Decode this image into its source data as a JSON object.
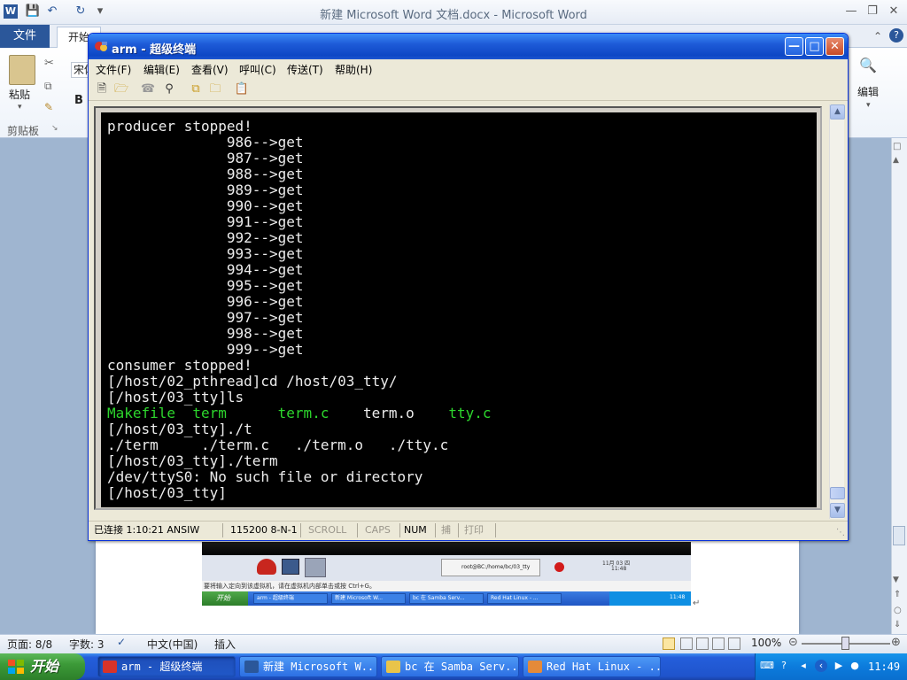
{
  "word": {
    "title": "新建 Microsoft Word 文档.docx  -  Microsoft Word",
    "tab_file": "文件",
    "tab_home": "开始",
    "paste_label": "粘贴",
    "clipboard_group": "剪贴板",
    "font_box": "宋体",
    "bold": "B",
    "edit_label": "编辑",
    "status": {
      "page": "页面: 8/8",
      "words": "字数: 3",
      "language": "中文(中国)",
      "insert_mode": "插入",
      "zoom": "100%"
    }
  },
  "embedded_screenshot": {
    "panel_path": "root@BC:/home/bc/03_tty",
    "panel_clock_date": "11月 03 四",
    "panel_clock_time": "11:48",
    "message": "要将输入定向到该虚拟机，请在虚拟机内部单击或按 Ctrl+G。",
    "start": "开始",
    "tasks": [
      "arm - 超级终端",
      "新建 Microsoft W...",
      "bc 在 Samba Serv...",
      "Red Hat Linux - ..."
    ],
    "tray_time": "11:48"
  },
  "hyperterminal": {
    "title": "arm - 超级终端",
    "menu": [
      "文件(F)",
      "编辑(E)",
      "查看(V)",
      "呼叫(C)",
      "传送(T)",
      "帮助(H)"
    ],
    "terminal_lines": [
      {
        "text": "producer stopped!",
        "color": "#ececec"
      },
      {
        "text": "              986-->get",
        "color": "#ececec"
      },
      {
        "text": "              987-->get",
        "color": "#ececec"
      },
      {
        "text": "              988-->get",
        "color": "#ececec"
      },
      {
        "text": "              989-->get",
        "color": "#ececec"
      },
      {
        "text": "              990-->get",
        "color": "#ececec"
      },
      {
        "text": "              991-->get",
        "color": "#ececec"
      },
      {
        "text": "              992-->get",
        "color": "#ececec"
      },
      {
        "text": "              993-->get",
        "color": "#ececec"
      },
      {
        "text": "              994-->get",
        "color": "#ececec"
      },
      {
        "text": "              995-->get",
        "color": "#ececec"
      },
      {
        "text": "              996-->get",
        "color": "#ececec"
      },
      {
        "text": "              997-->get",
        "color": "#ececec"
      },
      {
        "text": "              998-->get",
        "color": "#ececec"
      },
      {
        "text": "              999-->get",
        "color": "#ececec"
      },
      {
        "text": "consumer stopped!",
        "color": "#ececec"
      },
      {
        "text": "[/host/02_pthread]cd /host/03_tty/",
        "color": "#ececec"
      },
      {
        "text": "[/host/03_tty]ls",
        "color": "#ececec"
      }
    ],
    "ls_output": [
      "Makefile",
      "term",
      "term.c",
      "term.o",
      "tty.c"
    ],
    "terminal_lines_after": [
      "[/host/03_tty]./t",
      "./term     ./term.c   ./term.o   ./tty.c",
      "[/host/03_tty]./term",
      "/dev/ttyS0: No such file or directory",
      "[/host/03_tty]"
    ],
    "status": {
      "connection": "已连接 1:10:21",
      "emulation": "ANSIW",
      "port_settings": "115200 8-N-1",
      "scroll": "SCROLL",
      "caps": "CAPS",
      "num": "NUM",
      "capture": "捕",
      "print": "打印"
    }
  },
  "taskbar": {
    "start": "开始",
    "tasks": [
      "arm - 超级终端",
      "新建 Microsoft W...",
      "bc 在 Samba Serv...",
      "Red Hat Linux - ..."
    ],
    "clock": "11:49",
    "colors": {
      "start_green": "#3c9a38",
      "bar_blue": "#245edb"
    }
  }
}
